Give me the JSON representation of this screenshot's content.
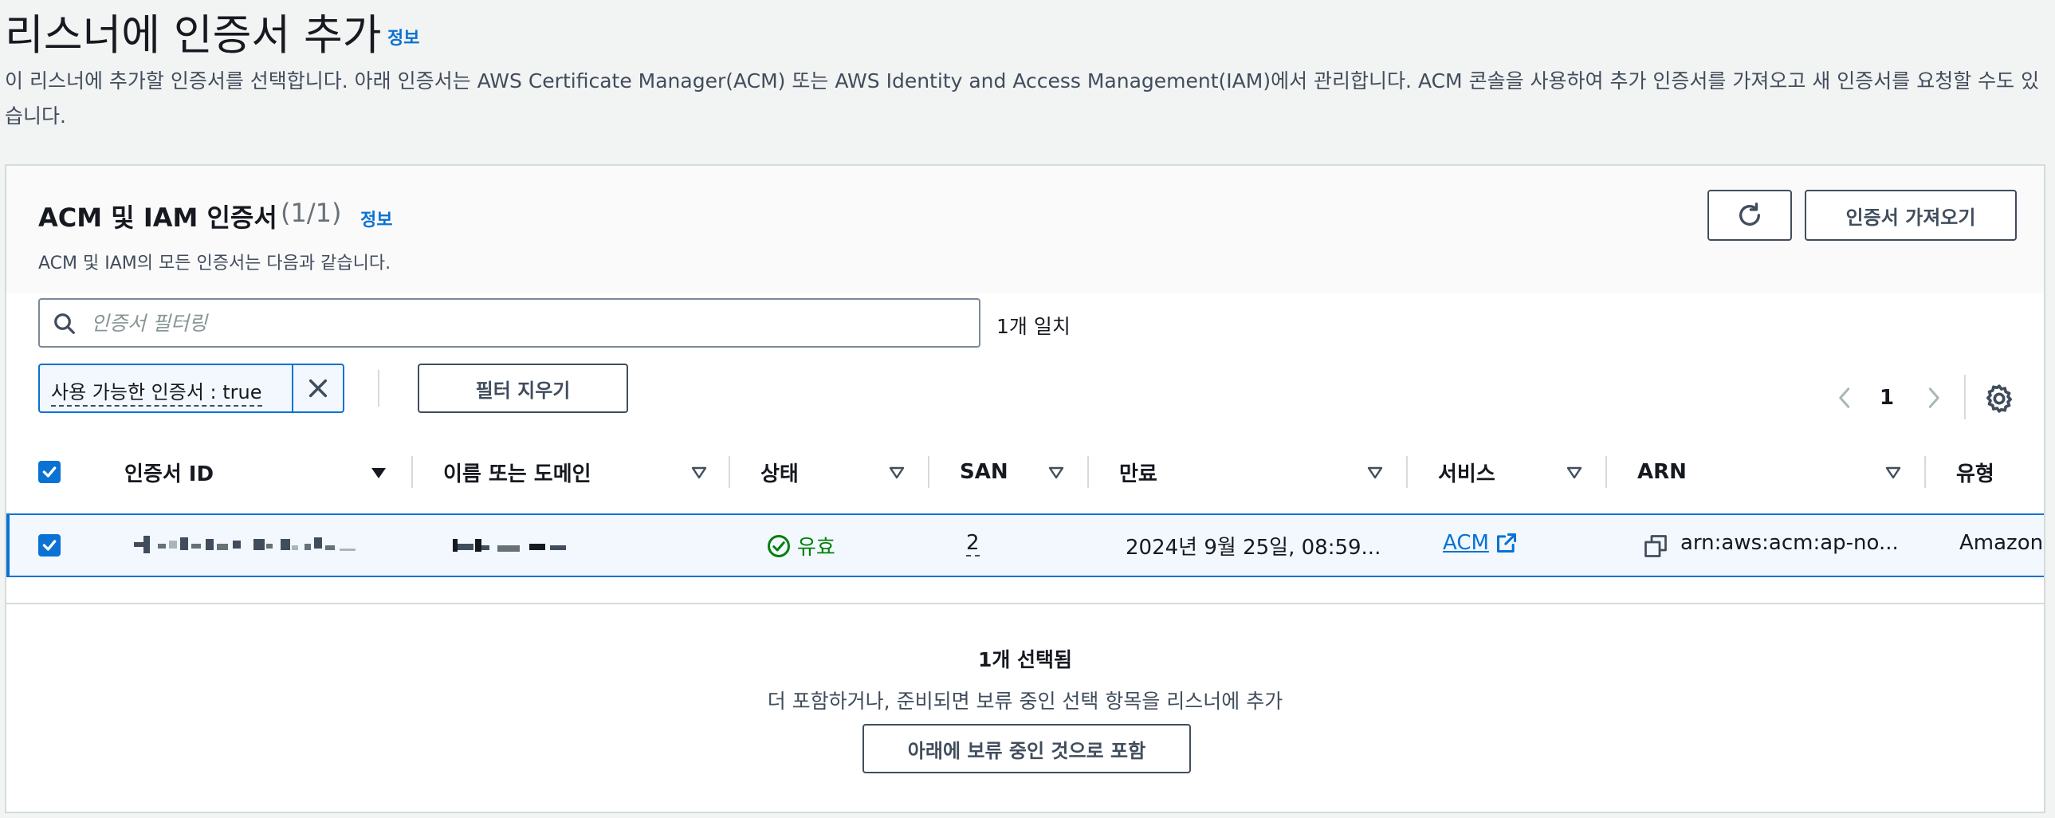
{
  "page": {
    "title": "리스너에 인증서 추가",
    "info_label": "정보",
    "description": "이 리스너에 추가할 인증서를 선택합니다. 아래 인증서는 AWS Certificate Manager(ACM) 또는 AWS Identity and Access Management(IAM)에서 관리합니다. ACM 콘솔을 사용하여 추가 인증서를 가져오고 새 인증서를 요청할 수도 있습니다."
  },
  "panel": {
    "title": "ACM 및 IAM 인증서",
    "count": "(1/1)",
    "info_label": "정보",
    "description": "ACM 및 IAM의 모든 인증서는 다음과 같습니다.",
    "import_button": "인증서 가져오기",
    "refresh_icon": "refresh-icon"
  },
  "filter": {
    "placeholder": "인증서 필터링",
    "match_count": "1개 일치",
    "token_label": "사용 가능한 인증서 : true",
    "clear_button": "필터 지우기"
  },
  "pagination": {
    "current_page": "1"
  },
  "table": {
    "columns": [
      "인증서 ID",
      "이름 또는 도메인",
      "상태",
      "SAN",
      "만료",
      "서비스",
      "ARN",
      "유형"
    ],
    "rows": [
      {
        "selected": true,
        "status": "유효",
        "san": "2",
        "expiry": "2024년 9월 25일, 08:59...",
        "service": "ACM",
        "arn": "arn:aws:acm:ap-no...",
        "type": "Amazon"
      }
    ]
  },
  "selection": {
    "count_text": "1개 선택됨",
    "hint": "더 포함하거나, 준비되면 보류 중인 선택 항목을 리스너에 추가",
    "include_button": "아래에 보류 중인 것으로 포함"
  },
  "colors": {
    "accent": "#0972d3",
    "success": "#037f0c",
    "text": "#16191f",
    "muted": "#414d5c"
  }
}
